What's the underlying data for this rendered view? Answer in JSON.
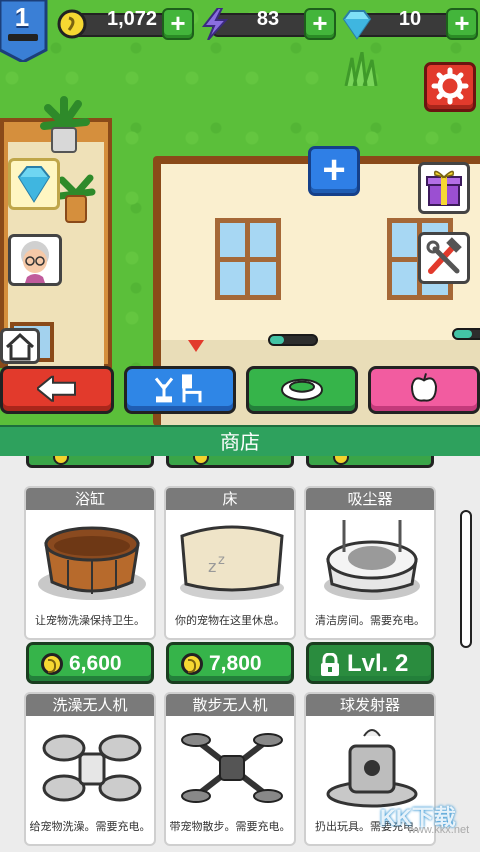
{
  "hud": {
    "level": "1",
    "coins": "1,072",
    "energy": "83",
    "gems": "10"
  },
  "shop": {
    "title": "商店",
    "items": [
      {
        "name": "浴缸",
        "desc": "让宠物洗澡保持卫生。",
        "price": "6,600",
        "locked": false
      },
      {
        "name": "床",
        "desc": "你的宠物在这里休息。",
        "price": "7,800",
        "locked": false
      },
      {
        "name": "吸尘器",
        "desc": "清洁房间。需要充电。",
        "price": "Lvl. 2",
        "locked": true
      },
      {
        "name": "洗澡无人机",
        "desc": "给宠物洗澡。需要充电。"
      },
      {
        "name": "散步无人机",
        "desc": "带宠物散步。需要充电。"
      },
      {
        "name": "球发射器",
        "desc": "扔出玩具。需要充电。"
      }
    ]
  },
  "progress": {
    "tv_stand": 0.3,
    "right_item": 0.5
  },
  "watermark": {
    "text": "KK下载",
    "sub": "www.kkx.net"
  },
  "colors": {
    "shop_header": "#2ea15d",
    "buy_button": "#36b44a",
    "back_button": "#e23a2c",
    "furniture_button": "#2f86e6",
    "food_button": "#f25ca0"
  }
}
